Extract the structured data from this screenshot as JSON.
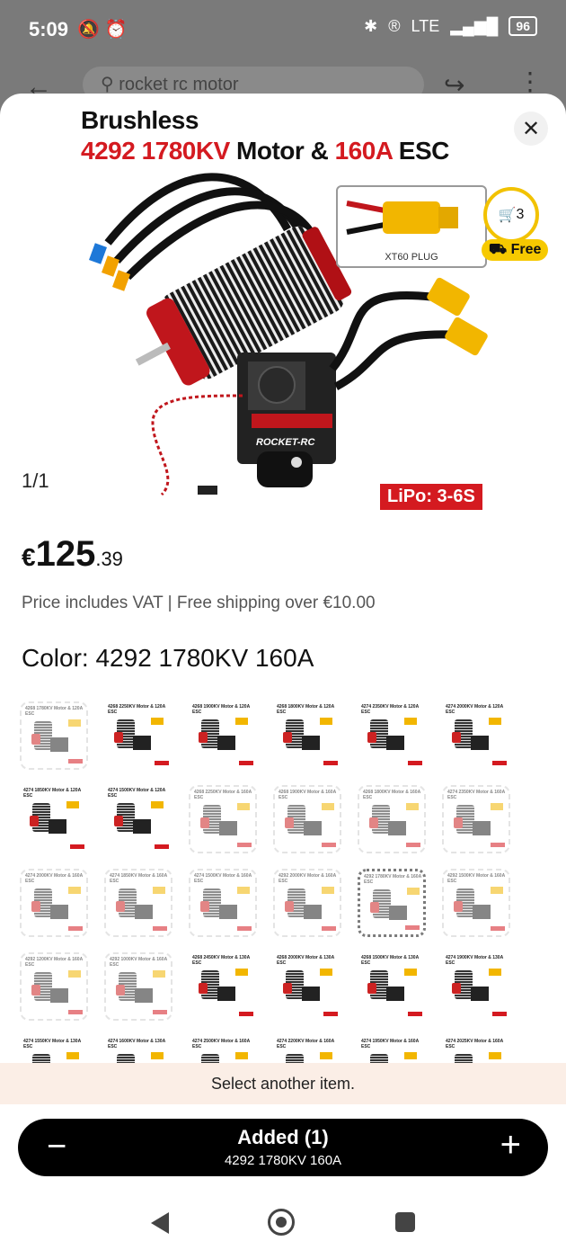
{
  "status_bar": {
    "time": "5:09",
    "left_icons": "🔕 ⏰",
    "network": "LTE",
    "battery": "96"
  },
  "background": {
    "search_text": "rocket rc motor"
  },
  "product": {
    "image_title_line1": "Brushless",
    "image_title_line2_red1": "4292 1780KV",
    "image_title_line2_black1": " Motor & ",
    "image_title_line2_red2": "160A",
    "image_title_line2_black2": " ESC",
    "plug_label": "XT60 PLUG",
    "lipo_badge": "LiPo: 3-6S",
    "esc_brand": "ROCKET-RC",
    "image_index": "1/1"
  },
  "cart_badge": {
    "count": "3",
    "free_label": "Free"
  },
  "price": {
    "currency": "€",
    "integer": "125",
    "decimal": ".39"
  },
  "vat_line": "Price includes VAT | Free shipping over €10.00",
  "color": {
    "label": "Color:",
    "value": "4292 1780KV 160A"
  },
  "swatches": [
    {
      "title": "4268 1780KV Motor & 120A ESC",
      "state": "dim"
    },
    {
      "title": "4268 2250KV Motor & 120A ESC",
      "state": "normal"
    },
    {
      "title": "4268 1900KV Motor & 120A ESC",
      "state": "normal"
    },
    {
      "title": "4268 1800KV Motor & 120A ESC",
      "state": "normal"
    },
    {
      "title": "4274 2350KV Motor & 120A ESC",
      "state": "normal"
    },
    {
      "title": "4274 2000KV Motor & 120A ESC",
      "state": "normal"
    },
    {
      "title": "4274 1850KV Motor & 120A ESC",
      "state": "normal"
    },
    {
      "title": "4274 1500KV Motor & 120A ESC",
      "state": "normal"
    },
    {
      "title": "4268 2250KV Motor & 160A ESC",
      "state": "dim"
    },
    {
      "title": "4268 1900KV Motor & 160A ESC",
      "state": "dim"
    },
    {
      "title": "4268 1800KV Motor & 160A ESC",
      "state": "dim"
    },
    {
      "title": "4274 2350KV Motor & 160A ESC",
      "state": "dim"
    },
    {
      "title": "4274 2000KV Motor & 160A ESC",
      "state": "dim"
    },
    {
      "title": "4274 1850KV Motor & 160A ESC",
      "state": "dim"
    },
    {
      "title": "4274 1500KV Motor & 160A ESC",
      "state": "dim"
    },
    {
      "title": "4292 2000KV Motor & 160A ESC",
      "state": "dim"
    },
    {
      "title": "4292 1780KV Motor & 160A ESC",
      "state": "selected"
    },
    {
      "title": "4292 1500KV Motor & 160A ESC",
      "state": "dim"
    },
    {
      "title": "4292 1200KV Motor & 160A ESC",
      "state": "dim"
    },
    {
      "title": "4292 1000KV Motor & 160A ESC",
      "state": "dim"
    },
    {
      "title": "4268 2450KV Motor & 130A ESC",
      "state": "normal"
    },
    {
      "title": "4268 2000KV Motor & 130A ESC",
      "state": "normal"
    },
    {
      "title": "4268 1500KV Motor & 130A ESC",
      "state": "normal"
    },
    {
      "title": "4274 1900KV Motor & 130A ESC",
      "state": "normal"
    },
    {
      "title": "4274 1550KV Motor & 130A ESC",
      "state": "normal"
    },
    {
      "title": "4274 1600KV Motor & 130A ESC",
      "state": "normal"
    },
    {
      "title": "4274 2500KV Motor & 160A ESC",
      "state": "normal"
    },
    {
      "title": "4274 2200KV Motor & 160A ESC",
      "state": "normal"
    },
    {
      "title": "4274 1950KV Motor & 160A ESC",
      "state": "normal"
    },
    {
      "title": "4274 2025KV Motor & 160A ESC",
      "state": "normal"
    }
  ],
  "toast": "Select another item.",
  "cart_bar": {
    "title": "Added (1)",
    "subtitle": "4292 1780KV 160A",
    "minus": "−",
    "plus": "+"
  }
}
